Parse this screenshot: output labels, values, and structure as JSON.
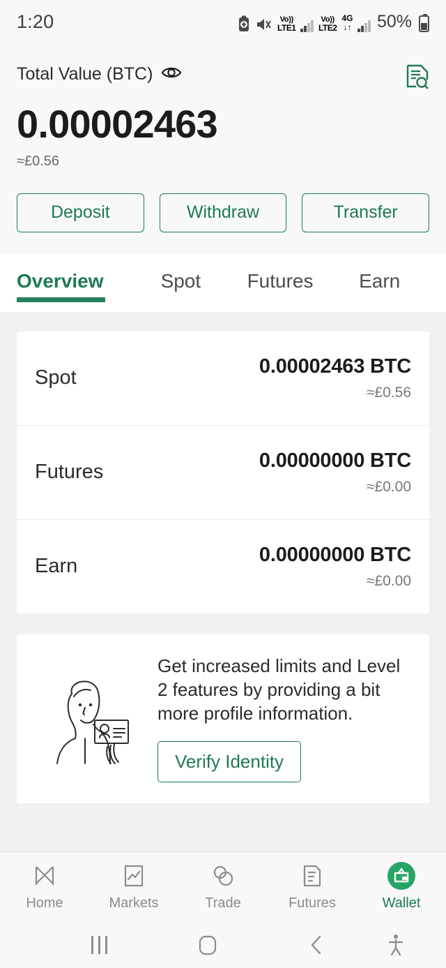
{
  "statusbar": {
    "time": "1:20",
    "icons": [
      "alarm-icon",
      "mute-icon"
    ],
    "sim1_label_top": "Vo))",
    "sim1_label_bottom": "LTE1",
    "sim2_label_top": "Vo))",
    "sim2_label_bottom": "LTE2",
    "network_type": "4G",
    "data_arrows": "↓↑",
    "battery_percent": "50%"
  },
  "header": {
    "total_label": "Total Value (BTC)",
    "visibility_icon": "eye-icon",
    "records_icon": "document-search-icon",
    "total_amount": "0.00002463",
    "total_fiat": "≈£0.56"
  },
  "actions": [
    {
      "label": "Deposit",
      "name": "deposit-button"
    },
    {
      "label": "Withdraw",
      "name": "withdraw-button"
    },
    {
      "label": "Transfer",
      "name": "transfer-button"
    }
  ],
  "tabs": [
    {
      "label": "Overview",
      "active": true
    },
    {
      "label": "Spot",
      "active": false
    },
    {
      "label": "Futures",
      "active": false
    },
    {
      "label": "Earn",
      "active": false
    }
  ],
  "balances": [
    {
      "name": "Spot",
      "amount": "0.00002463 BTC",
      "fiat": "≈£0.56"
    },
    {
      "name": "Futures",
      "amount": "0.00000000 BTC",
      "fiat": "≈£0.00"
    },
    {
      "name": "Earn",
      "amount": "0.00000000 BTC",
      "fiat": "≈£0.00"
    }
  ],
  "verify": {
    "illustration": "person-holding-id-card-illustration",
    "text": "Get increased limits and Level 2 features by providing a bit more profile information.",
    "button_label": "Verify Identity"
  },
  "bottomnav": [
    {
      "label": "Home",
      "icon": "home-logo-icon",
      "active": false
    },
    {
      "label": "Markets",
      "icon": "chart-box-icon",
      "active": false
    },
    {
      "label": "Trade",
      "icon": "two-coins-icon",
      "active": false
    },
    {
      "label": "Futures",
      "icon": "document-icon",
      "active": false
    },
    {
      "label": "Wallet",
      "icon": "wallet-icon",
      "active": true
    }
  ],
  "sysnav": {
    "recents": "recents-icon",
    "home": "home-icon",
    "back": "back-icon",
    "accessibility": "accessibility-icon"
  },
  "colors": {
    "accent_green": "#1e7a52",
    "tab_underline": "#25815a",
    "page_bg": "#f1f1f1",
    "card_bg": "#ffffff",
    "header_bg": "#f8f8f8"
  }
}
